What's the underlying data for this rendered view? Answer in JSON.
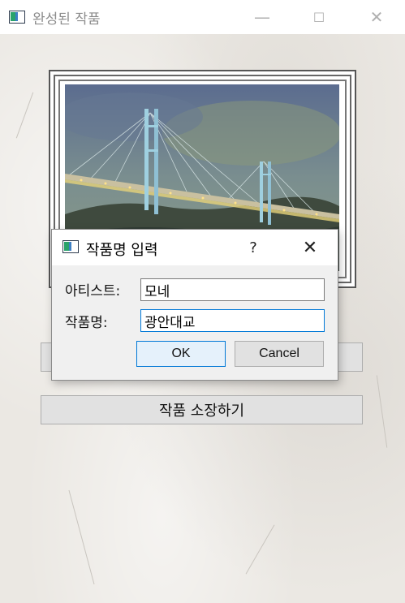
{
  "window": {
    "title": "완성된 작품",
    "minimize_glyph": "—",
    "maximize_glyph": "☐",
    "close_glyph": "✕"
  },
  "main": {
    "hidden_button_label": "",
    "collect_button_label": "작품 소장하기"
  },
  "dialog": {
    "title": "작품명 입력",
    "help_glyph": "?",
    "close_glyph": "✕",
    "artist_label": "아티스트:",
    "artist_value": "모네",
    "title_label": "작품명:",
    "title_value": "광안대교",
    "ok_label": "OK",
    "cancel_label": "Cancel"
  },
  "colors": {
    "accent": "#0078d7",
    "button_bg": "#e1e1e1",
    "ok_bg": "#e5f1fb"
  }
}
